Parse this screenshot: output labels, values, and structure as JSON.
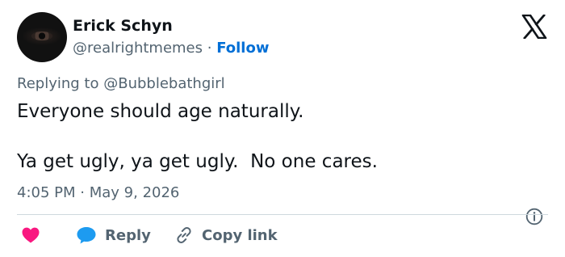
{
  "tweet": {
    "author_name": "Erick Schyn",
    "author_handle": "@realrightmemes",
    "separator": "·",
    "follow_label": "Follow",
    "replying_prefix": "Replying to",
    "replying_to": "@Bubblebathgirl",
    "text_line1": "Everyone should age naturally.",
    "text_line2": "Ya get ugly, ya get ugly.  No one cares.",
    "time": "4:05 PM",
    "date": "May 9, 2026"
  },
  "actions": {
    "reply_label": "Reply",
    "copy_label": "Copy link"
  },
  "icons": {
    "logo": "x-logo-icon",
    "info": "info-icon",
    "like": "heart-icon",
    "reply": "speech-bubble-icon",
    "copy": "link-icon"
  },
  "colors": {
    "heart": "#f91880",
    "reply_bubble": "#1d9bf0",
    "follow": "#006fd6",
    "secondary_text": "#536471"
  }
}
